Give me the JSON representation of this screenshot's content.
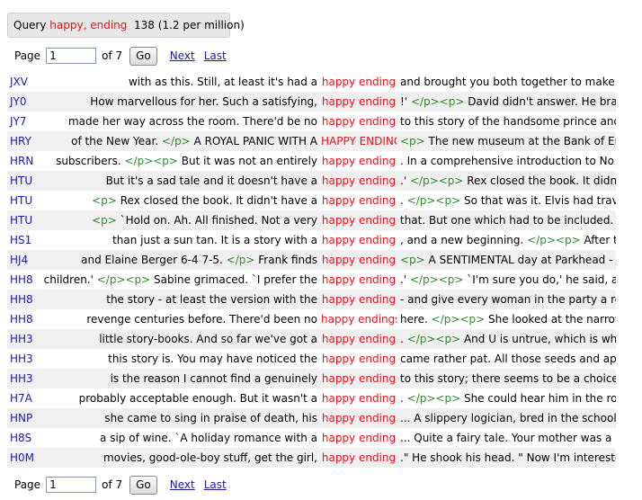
{
  "query": {
    "label": "Query",
    "term": "happy, ending",
    "count": "138",
    "rate": "(1.2 per million)"
  },
  "pager": {
    "page_label": "Page",
    "page_value": "1",
    "of_label": "of 7",
    "go_label": "Go",
    "next_label": "Next",
    "last_label": "Last"
  },
  "rows": [
    {
      "src": "JXV",
      "left": "with as this. Still, at least it's had a",
      "node": "happy ending",
      "right": [
        [
          "t",
          "and brought you both together to make up"
        ]
      ]
    },
    {
      "src": "JY0",
      "left": "How marvellous for her. Such a satisfying,",
      "node": "happy ending",
      "right": [
        [
          "t",
          "!' "
        ],
        [
          "g",
          "</p><p>"
        ],
        [
          "t",
          " David didn't answer. He braked"
        ]
      ]
    },
    {
      "src": "JY7",
      "left": "made her way across the room. There'd be no",
      "node": "happy ending",
      "right": [
        [
          "t",
          "to this story of the handsome prince and"
        ]
      ]
    },
    {
      "src": "HRY",
      "left": "of the New Year. </p> A ROYAL PANIC WITH A",
      "node": "HAPPY ENDING",
      "right": [
        [
          "g",
          "<p>"
        ],
        [
          "t",
          " The new museum at the Bank of England"
        ]
      ]
    },
    {
      "src": "HRN",
      "left": "subscribers. </p><p> But it was not an entirely",
      "node": "happy ending",
      "right": [
        [
          "t",
          ". In a comprehensive introduction to No"
        ]
      ]
    },
    {
      "src": "HTU",
      "left": "But it's a sad tale and it doesn't have a",
      "node": "happy ending",
      "right": [
        [
          "t",
          ".' "
        ],
        [
          "g",
          "</p><p>"
        ],
        [
          "t",
          " Rex closed the book. It didn't"
        ]
      ]
    },
    {
      "src": "HTU",
      "left": "<p> Rex closed the book. It didn't have a",
      "node": "happy ending",
      "right": [
        [
          "t",
          ". "
        ],
        [
          "g",
          "</p><p>"
        ],
        [
          "t",
          " So that was it. Elvis had travelled"
        ]
      ]
    },
    {
      "src": "HTU",
      "left": "<p> `Hold on. Ah. All finished. Not a very",
      "node": "happy ending",
      "right": [
        [
          "t",
          "that. But one which had to be included."
        ]
      ]
    },
    {
      "src": "HS1",
      "left": "than just a sun tan. It is a story with a",
      "node": "happy ending",
      "right": [
        [
          "t",
          ", and a new beginning. "
        ],
        [
          "g",
          "</p><p>"
        ],
        [
          "t",
          " After the church"
        ]
      ]
    },
    {
      "src": "HJ4",
      "left": "and Elaine Berger 6-4 7-5. </p> Frank finds",
      "node": "happy ending",
      "right": [
        [
          "g",
          "<p>"
        ],
        [
          "t",
          " A SENTIMENTAL day at Parkhead - the last"
        ]
      ]
    },
    {
      "src": "HH8",
      "left": "children.' </p><p> Sabine grimaced. `I prefer the",
      "node": "happy ending",
      "right": [
        [
          "t",
          ".' "
        ],
        [
          "g",
          "</p><p>"
        ],
        [
          "t",
          " `I'm sure you do,' he said, after"
        ]
      ]
    },
    {
      "src": "HH8",
      "left": "the story - at least the version with the",
      "node": "happy ending",
      "right": [
        [
          "t",
          "- and give every woman in the party a rose"
        ]
      ]
    },
    {
      "src": "HH8",
      "left": "revenge centuries before. There'd been no",
      "node": "happy endings",
      "right": [
        [
          "t",
          "here. "
        ],
        [
          "g",
          "</p><p>"
        ],
        [
          "t",
          " She looked at the narrow flight"
        ]
      ]
    },
    {
      "src": "HH3",
      "left": "little story-books. And so far we've got a",
      "node": "happy ending",
      "right": [
        [
          "t",
          ". "
        ],
        [
          "g",
          "</p><p>"
        ],
        [
          "t",
          " And U is untrue, which is what this"
        ]
      ]
    },
    {
      "src": "HH3",
      "left": "this story is. You may have noticed the",
      "node": "happy ending",
      "right": [
        [
          "t",
          "came rather pat. All those seeds and apples"
        ]
      ]
    },
    {
      "src": "HH3",
      "left": "is the reason I cannot find a genuinely",
      "node": "happy ending",
      "right": [
        [
          "t",
          "to this story; there seems to be a choice"
        ]
      ]
    },
    {
      "src": "H7A",
      "left": "probably acceptable enough. But it wasn't a",
      "node": "happy ending",
      "right": [
        [
          "t",
          ". "
        ],
        [
          "g",
          "</p><p>"
        ],
        [
          "t",
          " She could hear him in the room,"
        ]
      ]
    },
    {
      "src": "HNP",
      "left": "she came to sing in praise of death, his",
      "node": "happy ending",
      "right": [
        [
          "t",
          "... A slippery logician, bred in the schools"
        ]
      ]
    },
    {
      "src": "H8S",
      "left": "a sip of wine. `A holiday romance with a",
      "node": "happy ending",
      "right": [
        [
          "t",
          "... Quite a fairy tale. Your mother was a"
        ]
      ]
    },
    {
      "src": "H0M",
      "left": "movies, good-ole-boy stuff, get the girl,",
      "node": "happy ending",
      "right": [
        [
          "t",
          ".\" He shook his head. \" Now I'm interested"
        ]
      ]
    }
  ]
}
